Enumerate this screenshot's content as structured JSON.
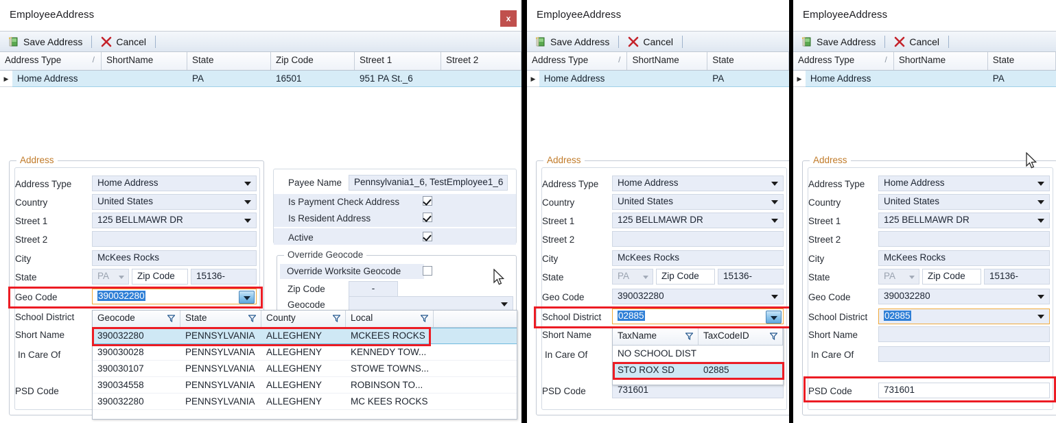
{
  "window": {
    "title": "EmployeeAddress",
    "close_label": "x"
  },
  "toolbar": {
    "save_label": "Save Address",
    "cancel_label": "Cancel",
    "save_icon": "save-address-icon",
    "cancel_icon": "cancel-x-icon"
  },
  "top_grid": {
    "columns": [
      "Address Type",
      "ShortName",
      "State",
      "Zip Code",
      "Street 1",
      "Street 2"
    ],
    "sort_marker": "/",
    "row": {
      "address_type": "Home Address",
      "short_name": "",
      "state": "PA",
      "zip_code": "16501",
      "street1": "951 PA St._6",
      "street2": ""
    },
    "row_expander": "▶"
  },
  "address_group": {
    "legend": "Address",
    "labels": {
      "address_type": "Address Type",
      "country": "Country",
      "street1": "Street 1",
      "street2": "Street 2",
      "city": "City",
      "state": "State",
      "zip_code": "Zip Code",
      "geo_code": "Geo Code",
      "school_district": "School District",
      "short_name": "Short Name",
      "in_care_of": "In Care Of",
      "psd_code": "PSD Code"
    },
    "values": {
      "address_type": "Home Address",
      "country": "United States",
      "street1": "125 BELLMAWR DR",
      "street2": "",
      "city": "McKees Rocks",
      "state": "PA",
      "zip_code": "15136-",
      "geo_code": "390032280",
      "school_district": "02885",
      "short_name": "",
      "in_care_of": "",
      "psd_code": "731601"
    }
  },
  "right_group": {
    "payee_name_label": "Payee Name",
    "payee_name_value": "Pennsylvania1_6, TestEmployee1_6",
    "checkboxes": [
      {
        "label": "Is Payment Check Address",
        "checked": true
      },
      {
        "label": "Is Resident Address",
        "checked": true
      },
      {
        "label": "Active",
        "checked": true
      }
    ],
    "override_legend": "Override Geocode",
    "override_worksite_label": "Override Worksite Geocode",
    "override_worksite_checked": false,
    "override_zip_label": "Zip Code",
    "override_zip_value": "-",
    "override_geocode_label": "Geocode",
    "override_geocode_value": ""
  },
  "geocode_popup": {
    "columns": [
      "Geocode",
      "State",
      "County",
      "Local"
    ],
    "rows": [
      {
        "geocode": "390032280",
        "state": "PENNSYLVANIA",
        "county": "ALLEGHENY",
        "local": "MCKEES ROCKS",
        "selected": true
      },
      {
        "geocode": "390030028",
        "state": "PENNSYLVANIA",
        "county": "ALLEGHENY",
        "local": "KENNEDY  TOW...",
        "selected": false
      },
      {
        "geocode": "390030107",
        "state": "PENNSYLVANIA",
        "county": "ALLEGHENY",
        "local": "STOWE  TOWNS...",
        "selected": false
      },
      {
        "geocode": "390034558",
        "state": "PENNSYLVANIA",
        "county": "ALLEGHENY",
        "local": "ROBINSON  TO...",
        "selected": false
      },
      {
        "geocode": "390032280",
        "state": "PENNSYLVANIA",
        "county": "ALLEGHENY",
        "local": "MC KEES ROCKS",
        "selected": false
      }
    ]
  },
  "school_popup": {
    "columns": [
      "TaxName",
      "TaxCodeID"
    ],
    "rows": [
      {
        "tax_name": "NO SCHOOL DIST",
        "tax_code_id": "",
        "selected": false
      },
      {
        "tax_name": "STO ROX SD",
        "tax_code_id": "02885",
        "selected": true
      }
    ]
  },
  "colors": {
    "annotation": "#ec1c24",
    "selection": "#2f7fd6",
    "grid_row_highlight": "#d7ecf7",
    "close_button": "#c0504d",
    "legend_text": "#c07a28"
  }
}
